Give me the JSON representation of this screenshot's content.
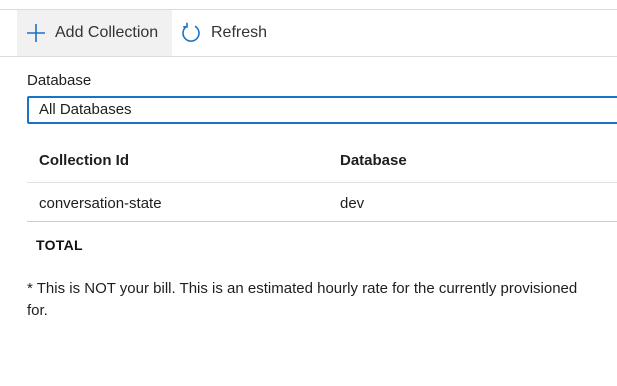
{
  "toolbar": {
    "add_collection_label": "Add Collection",
    "refresh_label": "Refresh",
    "accent_color": "#1a73c8"
  },
  "filter": {
    "database_label": "Database",
    "database_selected": "All Databases"
  },
  "table": {
    "headers": [
      "Collection Id",
      "Database"
    ],
    "rows": [
      [
        "conversation-state",
        "dev"
      ]
    ],
    "total_label": "TOTAL"
  },
  "note": {
    "line1": "* This is NOT your bill. This is an estimated hourly rate for the currently provisioned",
    "line2": "for."
  },
  "icons": {
    "add": "plus-icon",
    "refresh": "refresh-icon"
  }
}
